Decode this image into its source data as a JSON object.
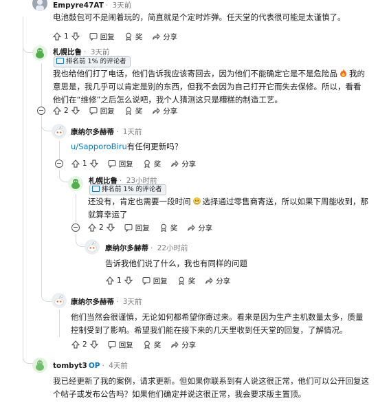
{
  "labels": {
    "reply": "回复",
    "award": "奖",
    "share": "分享"
  },
  "comments": [
    {
      "author": "Empyre47AT",
      "time": "3天前",
      "body": "电池鼓包可不是闹着玩的，简直就是个定时炸弹。任天堂的代表很可能是太谨慎了。",
      "votes": "1"
    },
    {
      "author": "札幌比鲁",
      "time": "3天前",
      "badge": "排名前 1% 的评论者",
      "body": "我也给他们打了电话，他们告诉我应该寄回去，因为他们不能确定它是不是危险品",
      "body2": "我的意思是，我几乎可以肯定是别的东西，但我不会因为自己打开它而失去保修。所以，看看他们在“维修”之后怎么说吧，我个人猜测这只是糟糕的制造工艺。",
      "votes": "2"
    },
    {
      "author": "康纳尔多赫蒂",
      "time": "1天前",
      "mention": "u/SapporoBiru",
      "body": "有任何更新吗？",
      "votes": "1"
    },
    {
      "author": "札幌比鲁",
      "time": "23小时前",
      "badge": "排名前 1% 的评论者",
      "body": "还没有，肯定也需要一段时间",
      "body2": "选择通过零售商寄送，所以如果下周能收到，那就算幸运了",
      "votes": "2"
    },
    {
      "author": "康纳尔多赫蒂",
      "time": "22小时前",
      "body": "告诉我他们说了什么，我也有同样的问题",
      "votes": "1"
    },
    {
      "author": "康纳尔多赫蒂",
      "time": "3天前",
      "body": "他们当然会很谨慎，无论如何都希望你寄过来。看来是因为生产主机数量太多，质量控制受到了影响。希望我们能在接下来的几天里收到任天堂的回复，了解情况。",
      "votes": "2"
    },
    {
      "author": "tombyt3",
      "op": "OP",
      "time": "4天前",
      "body": "我已经更新了我的案例，请求更新。但如果你联系到有人说这很正常，他们可以公开回复这个帖子或发布公告吗？如果他们确定并说这很正常，我会要求版主置顶。"
    }
  ]
}
